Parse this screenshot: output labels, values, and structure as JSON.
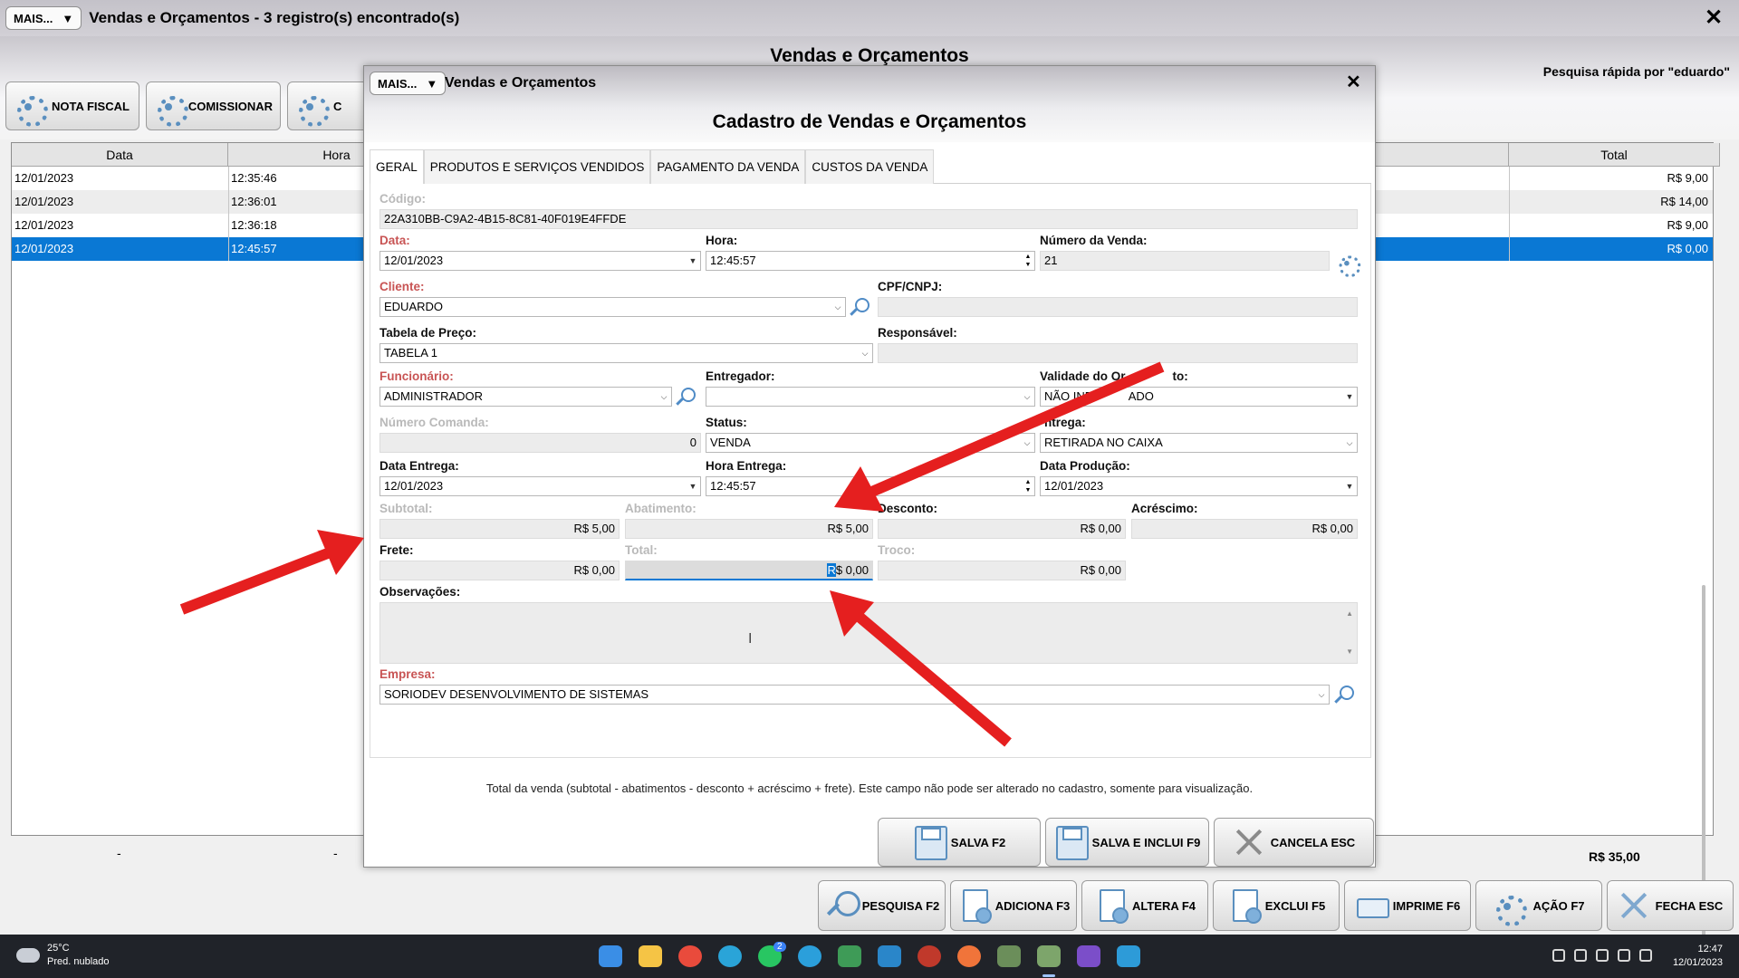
{
  "main": {
    "mais_label": "MAIS...",
    "window_title": "Vendas e Orçamentos - 3 registro(s) encontrado(s)",
    "heading": "Vendas e Orçamentos",
    "quick_search": "Pesquisa rápida por \"eduardo\"",
    "top_buttons": [
      "NOTA FISCAL",
      "COMISSIONAR",
      "C"
    ],
    "grid": {
      "headers": {
        "data": "Data",
        "hora": "Hora",
        "total": "Total"
      },
      "rows": [
        {
          "data": "12/01/2023",
          "hora": "12:35:46",
          "total": "R$ 9,00"
        },
        {
          "data": "12/01/2023",
          "hora": "12:36:01",
          "total": "R$ 14,00"
        },
        {
          "data": "12/01/2023",
          "hora": "12:36:18",
          "total": "R$ 9,00"
        },
        {
          "data": "12/01/2023",
          "hora": "12:45:57",
          "total": "R$ 0,00"
        }
      ],
      "footer_left": "-",
      "footer_mid": "-",
      "footer_total": "R$ 35,00"
    },
    "bottom_buttons": [
      "PESQUISA F2",
      "ADICIONA F3",
      "ALTERA F4",
      "EXCLUI F5",
      "IMPRIME F6",
      "AÇÃO F7",
      "FECHA ESC"
    ]
  },
  "dialog": {
    "mais_label": "MAIS...",
    "title": "Vendas e Orçamentos",
    "heading": "Cadastro de Vendas e Orçamentos",
    "tabs": [
      "GERAL",
      "PRODUTOS E SERVIÇOS VENDIDOS",
      "PAGAMENTO DA VENDA",
      "CUSTOS DA VENDA"
    ],
    "labels": {
      "codigo": "Código:",
      "data": "Data:",
      "hora": "Hora:",
      "numero_venda": "Número da Venda:",
      "cliente": "Cliente:",
      "cpf": "CPF/CNPJ:",
      "tabela_preco": "Tabela de Preço:",
      "responsavel": "Responsável:",
      "funcionario": "Funcionário:",
      "entregador": "Entregador:",
      "validade_a": "Validade do Or",
      "validade_b": "to:",
      "numero_comanda": "Número Comanda:",
      "status": "Status:",
      "entrega": "ntrega:",
      "data_entrega": "Data Entrega:",
      "hora_entrega": "Hora Entrega:",
      "data_producao": "Data Produção:",
      "subtotal": "Subtotal:",
      "abatimento": "Abatimento:",
      "desconto": "Desconto:",
      "acrescimo": "Acréscimo:",
      "frete": "Frete:",
      "total": "Total:",
      "troco": "Troco:",
      "observacoes": "Observações:",
      "empresa": "Empresa:"
    },
    "values": {
      "codigo": "22A310BB-C9A2-4B15-8C81-40F019E4FFDE",
      "data": "12/01/2023",
      "hora": "12:45:57",
      "numero_venda": "21",
      "cliente": "EDUARDO",
      "cpf": "",
      "tabela_preco": "TABELA 1",
      "responsavel": "",
      "funcionario": "ADMINISTRADOR",
      "entregador": "",
      "validade_a": "NÃO INF",
      "validade_b": "ADO",
      "numero_comanda": "0",
      "status": "VENDA",
      "entrega": "RETIRADA NO CAIXA",
      "data_entrega": "12/01/2023",
      "hora_entrega": "12:45:57",
      "data_producao": "12/01/2023",
      "subtotal": "R$ 5,00",
      "abatimento": "R$ 5,00",
      "desconto": "R$ 0,00",
      "acrescimo": "R$ 0,00",
      "frete": "R$ 0,00",
      "total_sel": "R",
      "total_rest": "$ 0,00",
      "troco": "R$ 0,00",
      "observacoes": "",
      "empresa": "SORIODEV DESENVOLVIMENTO DE SISTEMAS"
    },
    "note": "Total da venda (subtotal - abatimentos - desconto + acréscimo + frete). Este campo não pode ser alterado no cadastro, somente para visualização.",
    "buttons": [
      "SALVA F2",
      "SALVA E INCLUI F9",
      "CANCELA ESC"
    ]
  },
  "taskbar": {
    "temperature": "25°C",
    "weather": "Pred. nublado",
    "time": "12:47",
    "date": "12/01/2023",
    "whatsapp_badge": "2"
  },
  "colors": {
    "selection": "#0a78d4",
    "required_label": "#c85454",
    "annotation_arrow": "#e51f1f",
    "icon_blue": "#5a8fbf"
  }
}
